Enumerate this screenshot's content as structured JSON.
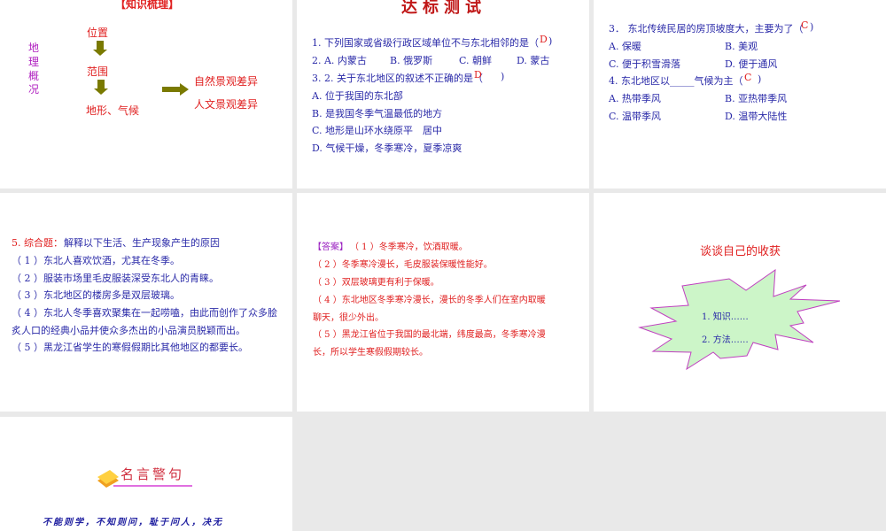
{
  "slides": [
    {
      "title": "【知识梳理】",
      "side": [
        "地",
        "理",
        "概",
        "况"
      ],
      "flow": [
        "位置",
        "范围",
        "地形、气候"
      ],
      "results": [
        "自然景观差异",
        "人文景观差异"
      ]
    },
    {
      "title": "达标测试",
      "lines": [
        "1. 下列国家或省级行政区域单位不与东北相邻的是（",
        "2. A. 内蒙古",
        "B. 俄罗斯",
        "C. 朝鲜",
        "D. 蒙古",
        "3. 2. 关于东北地区的叙述不正确的是（",
        "A. 位于我国的东北部",
        "B. 是我国冬季气温最低的地方",
        "C. 地形是山环水绕原平　居中",
        "D. 气候干燥，冬季寒冷，夏季凉爽"
      ],
      "answers": [
        "D",
        "D"
      ]
    },
    {
      "q3": "3． 东北传统民居的房顶坡度大，主要为了（",
      "q3_answer": "C",
      "q3_opts": [
        "A. 保暖",
        "B. 美观",
        "C. 便于积雪滑落",
        "D. 便于通风"
      ],
      "q4": "4. 东北地区以_____气候为主（",
      "q4_answer": "C",
      "q4_opts": [
        "A. 热带季风",
        "B. 亚热带季风",
        "C. 温带季风",
        "D. 温带大陆性"
      ]
    },
    {
      "label": "5. 综合题：",
      "intro": "解释以下生活、生产现象产生的原因",
      "items": [
        "（ 1 ）东北人喜欢饮酒，尤其在冬季。",
        "（ 2 ）服装市场里毛皮服装深受东北人的青睐。",
        "（ 3 ）东北地区的楼房多是双层玻璃。",
        "（ 4 ）东北人冬季喜欢聚集在一起唠嗑，由此而创作了众多脍",
        "炙人口的经典小品并使众多杰出的小品演员脱颖而出。",
        "（ 5 ）黑龙江省学生的寒假假期比其他地区的都要长。"
      ]
    },
    {
      "label": "【答案】",
      "lines": [
        "（ 1 ）冬季寒冷，饮酒取暖。",
        "（ 2 ）冬季寒冷漫长，毛皮服装保暖性能好。",
        "（ 3 ）双层玻璃更有利于保暖。",
        "（ 4 ）东北地区冬季寒冷漫长，漫长的冬季人们在室内取暖",
        "聊天，很少外出。",
        "（ 5 ）黑龙江省位于我国的最北端，纬度最高，冬季寒冷漫",
        "长，所以学生寒假假期较长。"
      ]
    },
    {
      "title": "谈谈自己的收获",
      "items": [
        "1. 知识……",
        "2. 方法……"
      ]
    },
    {
      "title": "名言警句",
      "quote": "不能则学，不知则问，耻于问人，决无"
    }
  ]
}
